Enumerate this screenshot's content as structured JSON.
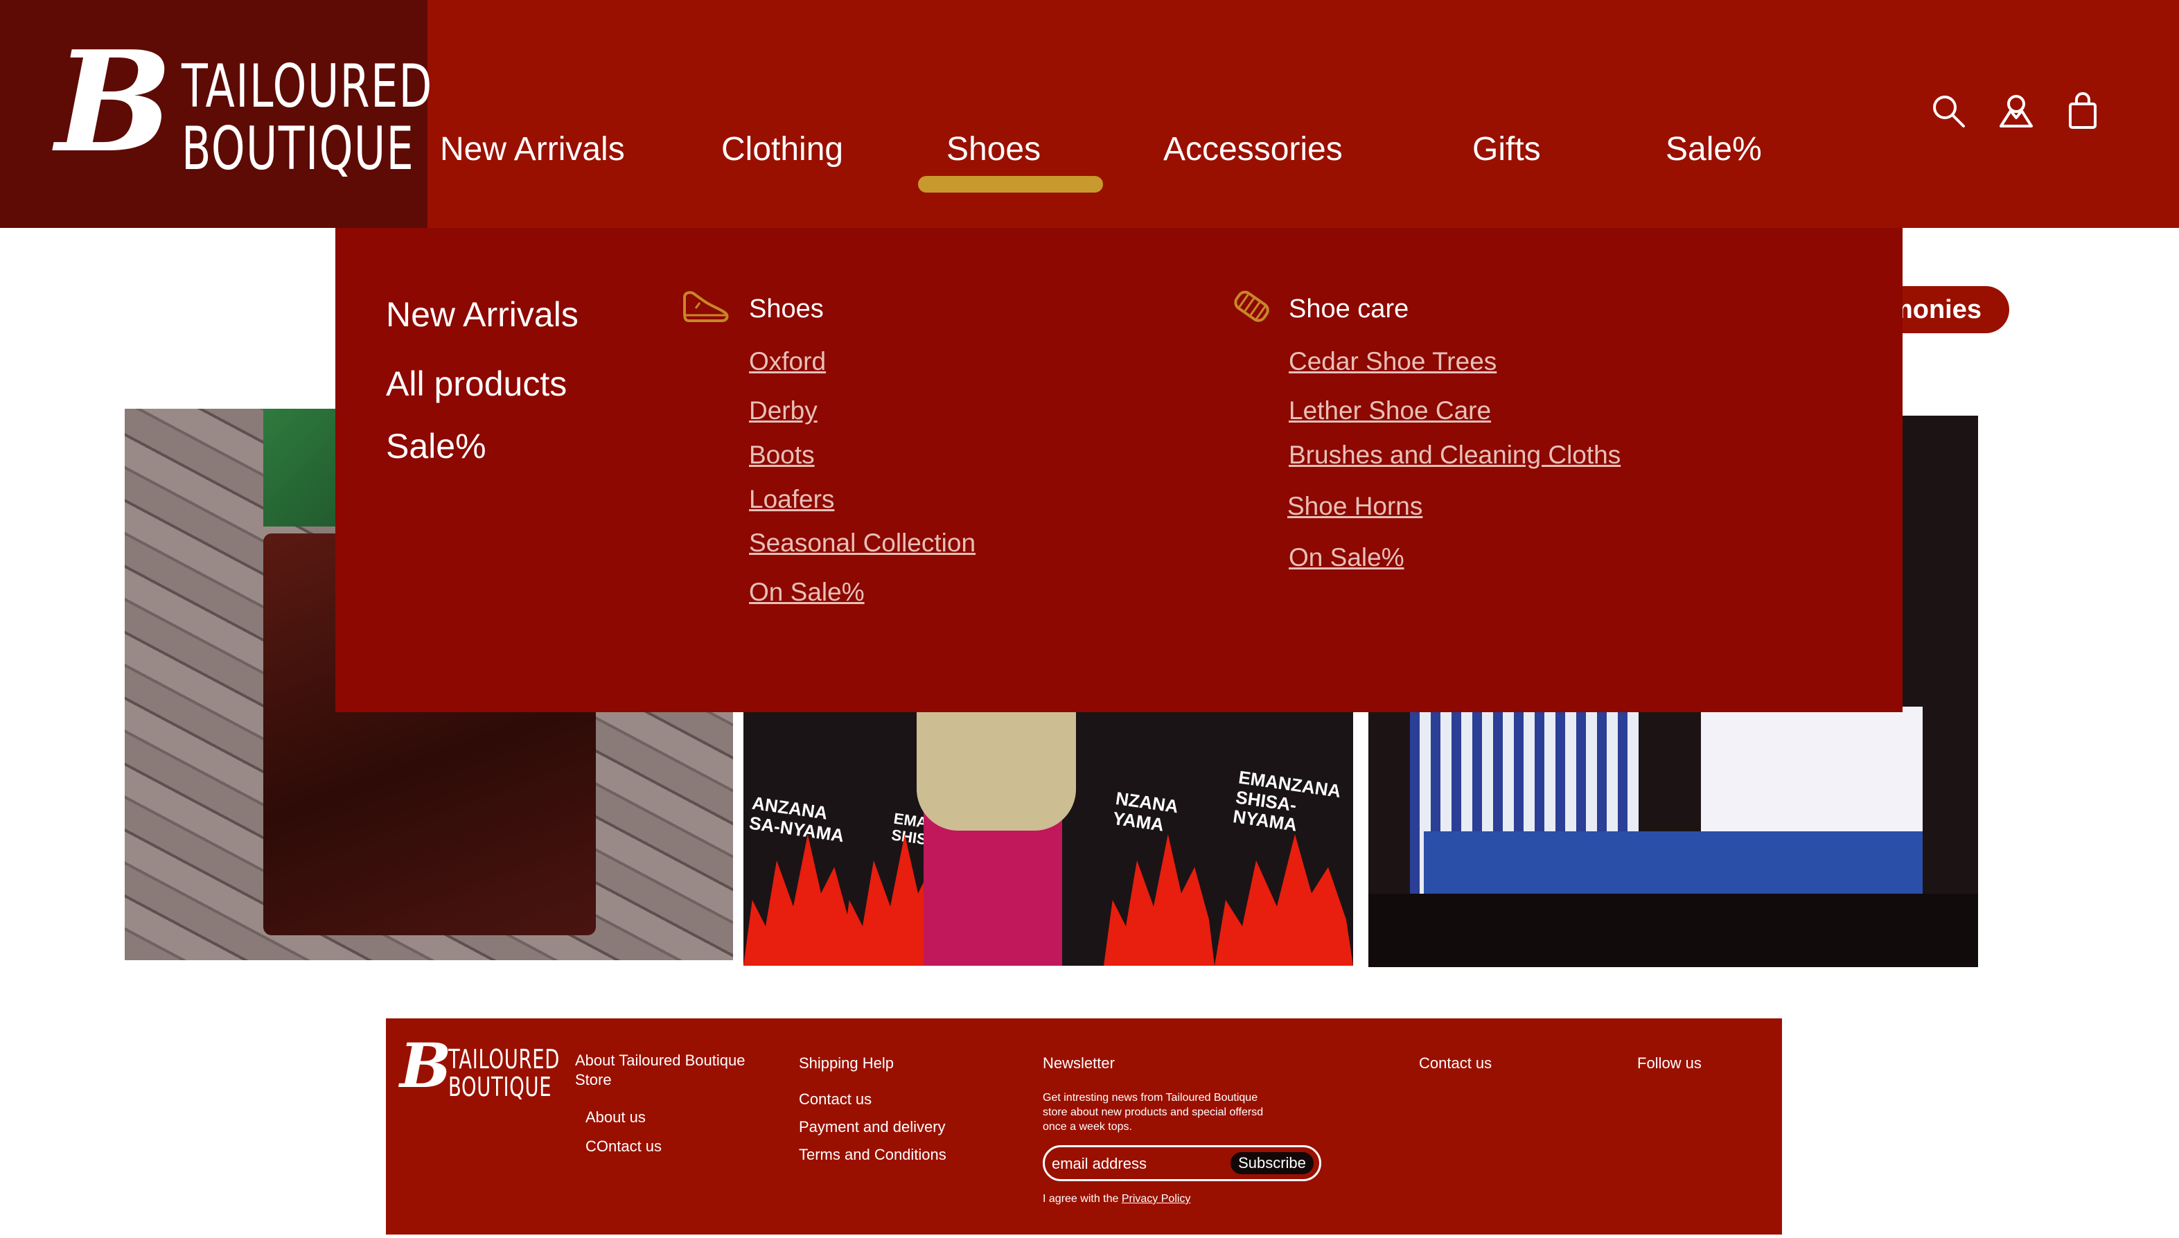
{
  "brand": {
    "letter": "B",
    "line1": "TAILOURED",
    "line2": "BOUTIQUE",
    "colors": {
      "header": "#9a1000",
      "logo_panel": "#5e0b05",
      "dropdown": "#8c0800",
      "accent": "#c89a2d"
    }
  },
  "nav": {
    "items": [
      {
        "label": "New Arrivals"
      },
      {
        "label": "Clothing"
      },
      {
        "label": "Shoes",
        "active": true
      },
      {
        "label": "Accessories"
      },
      {
        "label": "Gifts"
      },
      {
        "label": "Sale%"
      }
    ],
    "icons": [
      "search-icon",
      "account-icon",
      "shopping-bag-icon"
    ]
  },
  "testimonies_label": "imonies",
  "banner_text": {
    "line1": "EMANZANA",
    "line2": "SHISA-NYAMA",
    "partial1": "ANZANA",
    "partial2": "SA-NYAMA",
    "partial3": "EMA",
    "partial4": "SHISA",
    "partial5": "NZANA",
    "partial6": "YAMA"
  },
  "dropdown": {
    "main_links": [
      "New Arrivals",
      "All products",
      "Sale%"
    ],
    "shoes": {
      "heading": "Shoes",
      "icon": "shoe-icon",
      "links": [
        "Oxford",
        "Derby",
        "Boots",
        "Loafers",
        "Seasonal Collection",
        "On Sale%"
      ]
    },
    "shoe_care": {
      "heading": "Shoe care",
      "icon": "brush-icon",
      "links": [
        "Cedar Shoe Trees",
        "Lether Shoe Care",
        "Brushes and Cleaning  Cloths",
        "Shoe Horns",
        "On Sale%"
      ]
    }
  },
  "footer": {
    "logo_line1": "TAILOURED",
    "logo_line2": "BOUTIQUE",
    "about": {
      "heading_line1": "About Tailoured Boutique",
      "heading_line2": "Store",
      "links": [
        "About us",
        "COntact us"
      ]
    },
    "shipping": {
      "heading": "Shipping Help",
      "links": [
        "Contact us",
        "Payment and delivery",
        "Terms and Conditions"
      ]
    },
    "newsletter": {
      "heading": "Newsletter",
      "description": "Get intresting news  from Tailoured Boutique store about new products and special offersd once a week tops.",
      "email_placeholder": "email address",
      "subscribe_label": "Subscribe",
      "agree_text": "I agree with the ",
      "privacy_label": "Privacy Policy"
    },
    "contact_heading": "Contact us",
    "follow_heading": "Follow us"
  }
}
